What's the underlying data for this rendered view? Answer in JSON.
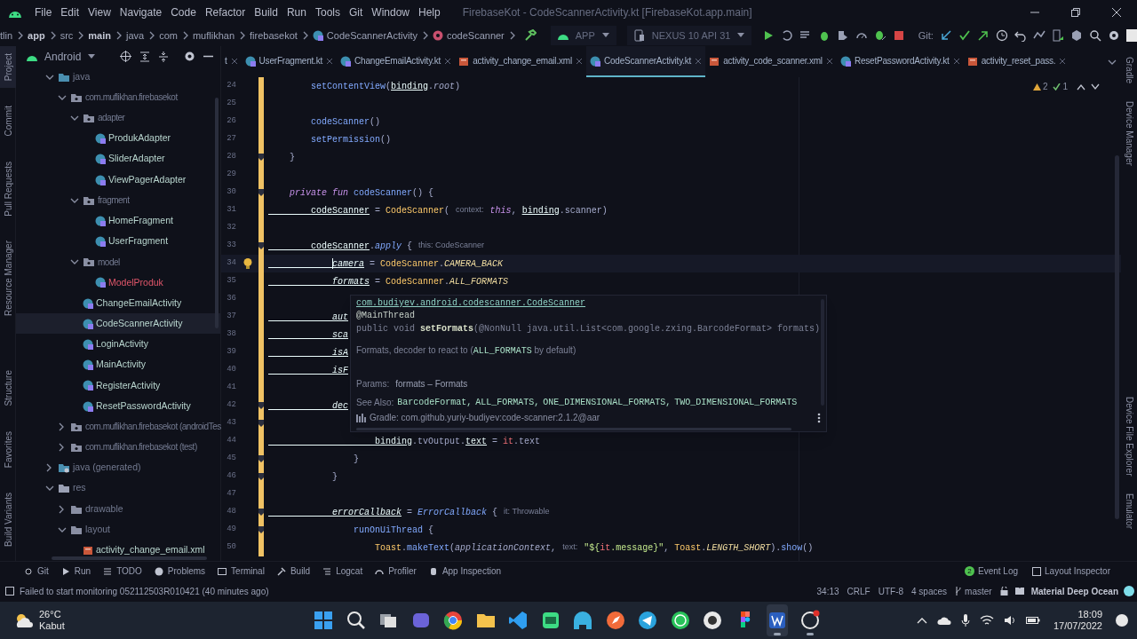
{
  "window": {
    "title": "FirebaseKot - CodeScannerActivity.kt [FirebaseKot.app.main]"
  },
  "menu": [
    "File",
    "Edit",
    "View",
    "Navigate",
    "Code",
    "Refactor",
    "Build",
    "Run",
    "Tools",
    "Git",
    "Window",
    "Help"
  ],
  "breadcrumbs": [
    {
      "label": "tlin",
      "kind": "text"
    },
    {
      "label": "app",
      "kind": "module"
    },
    {
      "label": "src",
      "kind": "text"
    },
    {
      "label": "main",
      "kind": "module"
    },
    {
      "label": "java",
      "kind": "text"
    },
    {
      "label": "com",
      "kind": "text"
    },
    {
      "label": "muflikhan",
      "kind": "text"
    },
    {
      "label": "firebasekot",
      "kind": "text"
    },
    {
      "label": "CodeScannerActivity",
      "kind": "class"
    },
    {
      "label": "codeScanner",
      "kind": "method"
    }
  ],
  "run_toolbar": {
    "configuration": "APP",
    "device": "NEXUS 10 API 31",
    "vcs_label": "Git:"
  },
  "left_tool_strip": {
    "top": [
      {
        "label": "Project",
        "selected": true
      },
      {
        "label": "Commit",
        "selected": false
      },
      {
        "label": "Pull Requests",
        "selected": false
      },
      {
        "label": "Resource Manager",
        "selected": false
      }
    ],
    "bottom": [
      {
        "label": "Structure",
        "selected": false
      },
      {
        "label": "Favorites",
        "selected": false
      },
      {
        "label": "Build Variants",
        "selected": false
      }
    ]
  },
  "right_tool_strip": {
    "top": [
      "Gradle",
      "Device Manager"
    ],
    "bottom": [
      "Device File Explorer",
      "Emulator"
    ]
  },
  "project_panel": {
    "view": "Android",
    "tree": [
      {
        "label": "java",
        "kind": "source",
        "expanded": true,
        "children": [
          {
            "label": "com.muflikhan.firebasekot",
            "kind": "package",
            "expanded": true,
            "children": [
              {
                "label": "adapter",
                "kind": "package",
                "expanded": true,
                "children": [
                  {
                    "label": "ProdukAdapter",
                    "kind": "kotlin",
                    "error": false,
                    "selected": false
                  },
                  {
                    "label": "SliderAdapter",
                    "kind": "kotlin",
                    "error": false,
                    "selected": false
                  },
                  {
                    "label": "ViewPagerAdapter",
                    "kind": "kotlin",
                    "error": false,
                    "selected": false
                  }
                ]
              },
              {
                "label": "fragment",
                "kind": "package",
                "expanded": true,
                "children": [
                  {
                    "label": "HomeFragment",
                    "kind": "kotlin",
                    "error": false,
                    "selected": false
                  },
                  {
                    "label": "UserFragment",
                    "kind": "kotlin",
                    "error": false,
                    "selected": false
                  }
                ]
              },
              {
                "label": "model",
                "kind": "package",
                "expanded": true,
                "children": [
                  {
                    "label": "ModelProduk",
                    "kind": "kotlin",
                    "error": true,
                    "selected": false
                  }
                ]
              },
              {
                "label": "ChangeEmailActivity",
                "kind": "kotlin",
                "error": false,
                "selected": false
              },
              {
                "label": "CodeScannerActivity",
                "kind": "kotlin",
                "error": false,
                "selected": true
              },
              {
                "label": "LoginActivity",
                "kind": "kotlin",
                "error": false,
                "selected": false
              },
              {
                "label": "MainActivity",
                "kind": "kotlin",
                "error": false,
                "selected": false
              },
              {
                "label": "RegisterActivity",
                "kind": "kotlin",
                "error": false,
                "selected": false
              },
              {
                "label": "ResetPasswordActivity",
                "kind": "kotlin",
                "error": false,
                "selected": false
              }
            ]
          },
          {
            "label": "com.muflikhan.firebasekot (androidTes",
            "kind": "package",
            "expanded": false
          },
          {
            "label": "com.muflikhan.firebasekot (test)",
            "kind": "package",
            "expanded": false
          }
        ]
      },
      {
        "label": "java (generated)",
        "kind": "generated",
        "expanded": false
      },
      {
        "label": "res",
        "kind": "resources",
        "expanded": true,
        "children": [
          {
            "label": "drawable",
            "kind": "folder",
            "expanded": false
          },
          {
            "label": "layout",
            "kind": "folder",
            "expanded": true,
            "children": [
              {
                "label": "activity_change_email.xml",
                "kind": "xml",
                "error": false,
                "selected": false
              }
            ]
          }
        ]
      }
    ]
  },
  "editor_tabs": [
    {
      "label": "t",
      "selected": false
    },
    {
      "label": "UserFragment.kt",
      "kind": "kotlin",
      "selected": false
    },
    {
      "label": "ChangeEmailActivity.kt",
      "kind": "kotlin",
      "selected": false
    },
    {
      "label": "activity_change_email.xml",
      "kind": "xml",
      "selected": false
    },
    {
      "label": "CodeScannerActivity.kt",
      "kind": "kotlin",
      "selected": true
    },
    {
      "label": "activity_code_scanner.xml",
      "kind": "xml",
      "selected": false
    },
    {
      "label": "ResetPasswordActivity.kt",
      "kind": "kotlin",
      "selected": false
    },
    {
      "label": "activity_reset_pass.",
      "kind": "xml",
      "selected": false
    }
  ],
  "inspections": [
    {
      "kind": "warning",
      "count": "2"
    },
    {
      "kind": "weak_warning",
      "count": "1"
    }
  ],
  "code": {
    "lines": [
      {
        "number": "24",
        "current": false,
        "changed": true,
        "tokens": [
          {
            "text": "        setContentView",
            "kind": "f"
          },
          {
            "text": "(",
            "kind": "p"
          },
          {
            "text": "binding",
            "kind": "u"
          },
          {
            "text": ".",
            "kind": "p"
          },
          {
            "text": "root",
            "kind": "i"
          },
          {
            "text": ")",
            "kind": "p"
          }
        ]
      },
      {
        "number": "25",
        "current": false,
        "changed": true
      },
      {
        "number": "26",
        "current": false,
        "changed": true,
        "tokens": [
          {
            "text": "        codeScanner",
            "kind": "f"
          },
          {
            "text": "()",
            "kind": "p"
          }
        ]
      },
      {
        "number": "27",
        "current": false,
        "changed": true,
        "tokens": [
          {
            "text": "        setPermission",
            "kind": "f"
          },
          {
            "text": "()",
            "kind": "p"
          }
        ]
      },
      {
        "number": "28",
        "current": false,
        "changed": true,
        "fold_marker": true,
        "tokens": [
          {
            "text": "    }",
            "kind": "p"
          }
        ]
      },
      {
        "number": "29",
        "current": false,
        "changed": true
      },
      {
        "number": "30",
        "current": false,
        "changed": true,
        "fold_marker": true,
        "tokens": [
          {
            "text": "    private fun ",
            "kind": "k"
          },
          {
            "text": "codeScanner",
            "kind": "f"
          },
          {
            "text": "() {",
            "kind": "p"
          }
        ]
      },
      {
        "number": "31",
        "current": false,
        "changed": true,
        "tokens": [
          {
            "text": "        codeScanner",
            "kind": "u"
          },
          {
            "text": " = ",
            "kind": "p"
          },
          {
            "text": "CodeScanner",
            "kind": "y"
          },
          {
            "text": "(",
            "kind": "p"
          },
          {
            "text": "context:",
            "kind": "h"
          },
          {
            "text": "this",
            "kind": "k"
          },
          {
            "text": ", ",
            "kind": "p"
          },
          {
            "text": "binding",
            "kind": "u"
          },
          {
            "text": ".scanner)",
            "kind": "p"
          }
        ]
      },
      {
        "number": "32",
        "current": false,
        "changed": true
      },
      {
        "number": "33",
        "current": false,
        "changed": true,
        "fold_marker": true,
        "tokens": [
          {
            "text": "        codeScanner",
            "kind": "u"
          },
          {
            "text": ".",
            "kind": "p"
          },
          {
            "text": "apply",
            "kind": "fi"
          },
          {
            "text": " {",
            "kind": "p"
          },
          {
            "text": "this: CodeScanner",
            "kind": "h"
          }
        ]
      },
      {
        "number": "34",
        "current": true,
        "changed": true,
        "intention_bulb": true,
        "tokens": [
          {
            "text": "            camera",
            "kind": "ui"
          },
          {
            "text": " = ",
            "kind": "p"
          },
          {
            "text": "CodeScanner",
            "kind": "y"
          },
          {
            "text": ".",
            "kind": "p"
          },
          {
            "text": "CAMERA_BACK",
            "kind": "c"
          }
        ]
      },
      {
        "number": "35",
        "current": false,
        "changed": true,
        "tokens": [
          {
            "text": "            formats",
            "kind": "ui"
          },
          {
            "text": " = ",
            "kind": "p"
          },
          {
            "text": "CodeScanner",
            "kind": "y"
          },
          {
            "text": ".",
            "kind": "p"
          },
          {
            "text": "ALL_FORMATS",
            "kind": "c"
          }
        ]
      },
      {
        "number": "36",
        "current": false,
        "changed": true
      },
      {
        "number": "37",
        "current": false,
        "changed": true,
        "tokens": [
          {
            "text": "            aut",
            "kind": "ui"
          }
        ]
      },
      {
        "number": "38",
        "current": false,
        "changed": true,
        "tokens": [
          {
            "text": "            sca",
            "kind": "ui"
          }
        ]
      },
      {
        "number": "39",
        "current": false,
        "changed": true,
        "tokens": [
          {
            "text": "            isA",
            "kind": "ui"
          }
        ]
      },
      {
        "number": "40",
        "current": false,
        "changed": true,
        "tokens": [
          {
            "text": "            isF",
            "kind": "ui"
          }
        ]
      },
      {
        "number": "41",
        "current": false,
        "changed": true
      },
      {
        "number": "42",
        "current": false,
        "changed": true,
        "fold_marker": true,
        "tokens": [
          {
            "text": "            dec",
            "kind": "ui"
          }
        ]
      },
      {
        "number": "43",
        "current": false,
        "changed": true,
        "fold_marker": true
      },
      {
        "number": "44",
        "current": false,
        "changed": true,
        "tokens": [
          {
            "text": "                    binding",
            "kind": "u"
          },
          {
            "text": ".tvOutput.",
            "kind": "p"
          },
          {
            "text": "text",
            "kind": "u"
          },
          {
            "text": " = ",
            "kind": "p"
          },
          {
            "text": "it",
            "kind": "r"
          },
          {
            "text": ".text",
            "kind": "p"
          }
        ]
      },
      {
        "number": "45",
        "current": false,
        "changed": true,
        "fold_marker": true,
        "tokens": [
          {
            "text": "                }",
            "kind": "p"
          }
        ]
      },
      {
        "number": "46",
        "current": false,
        "changed": true,
        "fold_marker": true,
        "tokens": [
          {
            "text": "            }",
            "kind": "p"
          }
        ]
      },
      {
        "number": "47",
        "current": false,
        "changed": true
      },
      {
        "number": "48",
        "current": false,
        "changed": true,
        "fold_marker": true,
        "tokens": [
          {
            "text": "            errorCallback",
            "kind": "ui"
          },
          {
            "text": " = ",
            "kind": "p"
          },
          {
            "text": "ErrorCallback",
            "kind": "fi"
          },
          {
            "text": " {",
            "kind": "p"
          },
          {
            "text": "it: Throwable",
            "kind": "h"
          }
        ]
      },
      {
        "number": "49",
        "current": false,
        "changed": true,
        "fold_marker": true,
        "tokens": [
          {
            "text": "                runOnUiThread",
            "kind": "f"
          },
          {
            "text": " {",
            "kind": "p"
          }
        ]
      },
      {
        "number": "50",
        "current": false,
        "changed": true,
        "tokens": [
          {
            "text": "                    Toast",
            "kind": "y"
          },
          {
            "text": ".",
            "kind": "p"
          },
          {
            "text": "makeText",
            "kind": "f"
          },
          {
            "text": "(",
            "kind": "p"
          },
          {
            "text": "applicationContext",
            "kind": "i"
          },
          {
            "text": ",",
            "kind": "p"
          },
          {
            "text": "text:",
            "kind": "h"
          },
          {
            "text": "\"${",
            "kind": "s"
          },
          {
            "text": "it",
            "kind": "r"
          },
          {
            "text": ".message}\"",
            "kind": "s"
          },
          {
            "text": ", ",
            "kind": "p"
          },
          {
            "text": "Toast",
            "kind": "y"
          },
          {
            "text": ".",
            "kind": "p"
          },
          {
            "text": "LENGTH_SHORT",
            "kind": "c"
          },
          {
            "text": ").",
            "kind": "p"
          },
          {
            "text": "show",
            "kind": "f"
          },
          {
            "text": "()",
            "kind": "p"
          }
        ]
      }
    ]
  },
  "doc_popup": {
    "class_link": "com.budiyev.android.codescanner.CodeScanner",
    "annotation": "@MainThread",
    "signature": [
      {
        "text": "public void ",
        "kind": "dim"
      },
      {
        "text": "setFormats",
        "kind": "name"
      },
      {
        "text": "(@NonNull java.util.List<com.google.zxing.BarcodeFormat> formats)",
        "kind": "dim"
      }
    ],
    "description": [
      {
        "text": "Formats, decoder to react to (",
        "kind": "sans"
      },
      {
        "text": "ALL_FORMATS",
        "kind": "code"
      },
      {
        "text": " by default)",
        "kind": "sans"
      }
    ],
    "params_label": "Params:",
    "params": "formats – Formats",
    "see_also_label": "See Also:",
    "see_also": [
      "BarcodeFormat,",
      "ALL_FORMATS,",
      "ONE_DIMENSIONAL_FORMATS,",
      "TWO_DIMENSIONAL_FORMATS"
    ],
    "source": "Gradle: com.github.yuriy-budiyev:code-scanner:2.1.2@aar"
  },
  "bottom_tools": [
    "Git",
    "Run",
    "TODO",
    "Problems",
    "Terminal",
    "Build",
    "Logcat",
    "Profiler",
    "App Inspection"
  ],
  "event_log": {
    "label": "Event Log",
    "count": "2"
  },
  "layout_inspector": "Layout Inspector",
  "status_bar": {
    "message": "Failed to start monitoring 052112503R010421 (40 minutes ago)",
    "position": "34:13",
    "line_ending": "CRLF",
    "encoding": "UTF-8",
    "indent": "4 spaces",
    "branch": "master",
    "theme": "Material Deep Ocean"
  },
  "taskbar": {
    "weather": {
      "temperature": "26°C",
      "condition": "Kabut"
    },
    "apps": [
      {
        "kind": "windows",
        "running": false
      },
      {
        "kind": "search",
        "running": false
      },
      {
        "kind": "taskview",
        "running": false
      },
      {
        "kind": "chat",
        "running": false
      },
      {
        "kind": "browser",
        "running": false
      },
      {
        "kind": "files",
        "running": false
      },
      {
        "kind": "code",
        "running": false
      },
      {
        "kind": "green",
        "running": false
      },
      {
        "kind": "elephant",
        "running": false
      },
      {
        "kind": "compass",
        "running": false
      },
      {
        "kind": "telegram",
        "running": false
      },
      {
        "kind": "whatsapp",
        "running": false
      },
      {
        "kind": "game",
        "running": false
      },
      {
        "kind": "figma",
        "running": false
      },
      {
        "kind": "writer",
        "running": true
      },
      {
        "kind": "record",
        "running": true
      }
    ],
    "time": "18:09",
    "date": "17/07/2022"
  }
}
